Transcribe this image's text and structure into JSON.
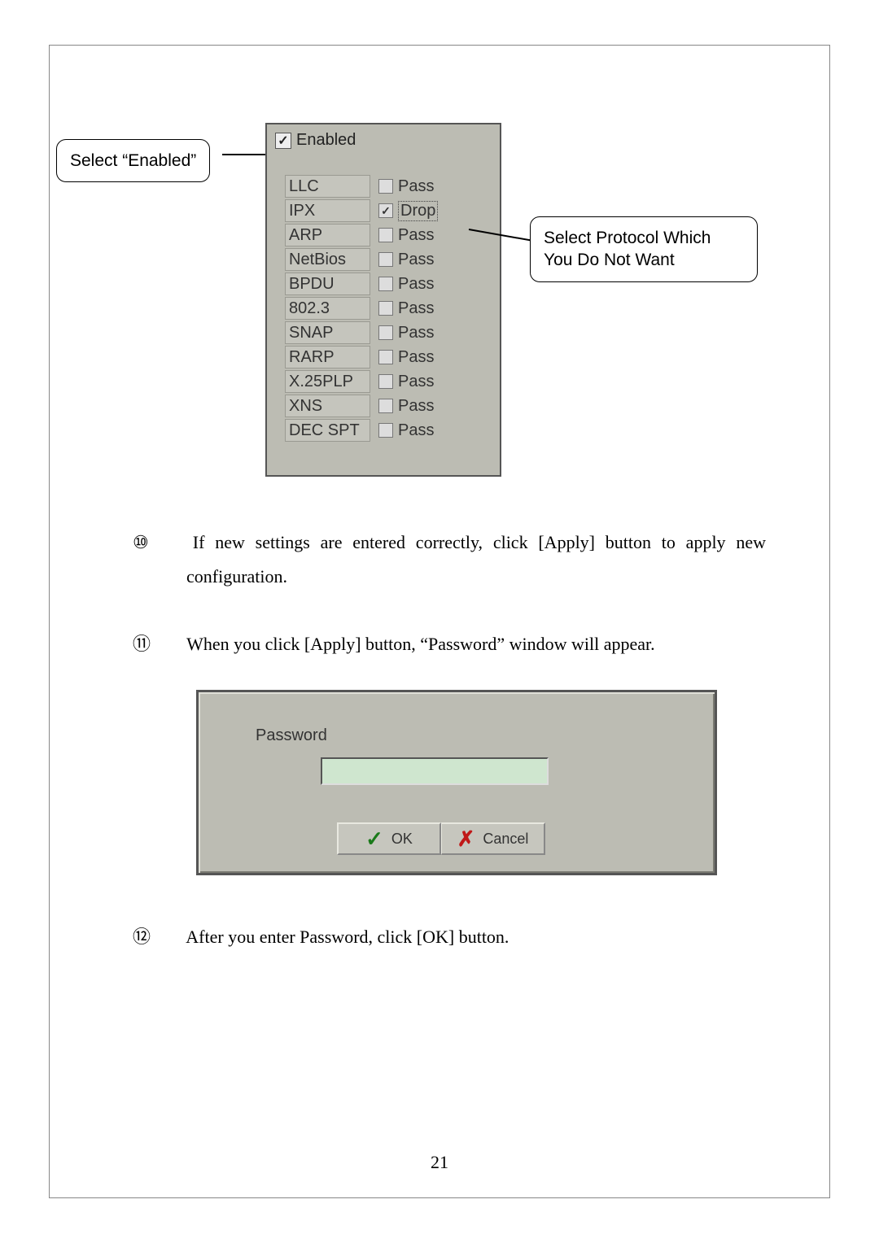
{
  "callouts": {
    "left": "Select “Enabled”",
    "right_line1": "Select Protocol Which",
    "right_line2": "You Do Not Want"
  },
  "protocolBox": {
    "enabled": {
      "label": "Enabled",
      "checked": true
    },
    "rows": [
      {
        "name": "LLC",
        "action": "Pass",
        "checked": false,
        "dotted": false
      },
      {
        "name": "IPX",
        "action": "Drop",
        "checked": true,
        "dotted": true
      },
      {
        "name": "ARP",
        "action": "Pass",
        "checked": false,
        "dotted": false
      },
      {
        "name": "NetBios",
        "action": "Pass",
        "checked": false,
        "dotted": false
      },
      {
        "name": "BPDU",
        "action": "Pass",
        "checked": false,
        "dotted": false
      },
      {
        "name": "802.3",
        "action": "Pass",
        "checked": false,
        "dotted": false
      },
      {
        "name": "SNAP",
        "action": "Pass",
        "checked": false,
        "dotted": false
      },
      {
        "name": "RARP",
        "action": "Pass",
        "checked": false,
        "dotted": false
      },
      {
        "name": "X.25PLP",
        "action": "Pass",
        "checked": false,
        "dotted": false
      },
      {
        "name": "XNS",
        "action": "Pass",
        "checked": false,
        "dotted": false
      },
      {
        "name": "DEC SPT",
        "action": "Pass",
        "checked": false,
        "dotted": false
      }
    ]
  },
  "items": {
    "n10": {
      "num": "⑩",
      "text": "If new settings are entered correctly, click [Apply] button to apply new configuration."
    },
    "n11": {
      "num": "⑪",
      "text": "When you click [Apply] button, “Password” window will appear."
    },
    "n12": {
      "num": "⑫",
      "text": "After you enter Password, click [OK] button."
    }
  },
  "passwordDialog": {
    "label": "Password",
    "ok": "OK",
    "cancel": "Cancel"
  },
  "pageNumber": "21"
}
